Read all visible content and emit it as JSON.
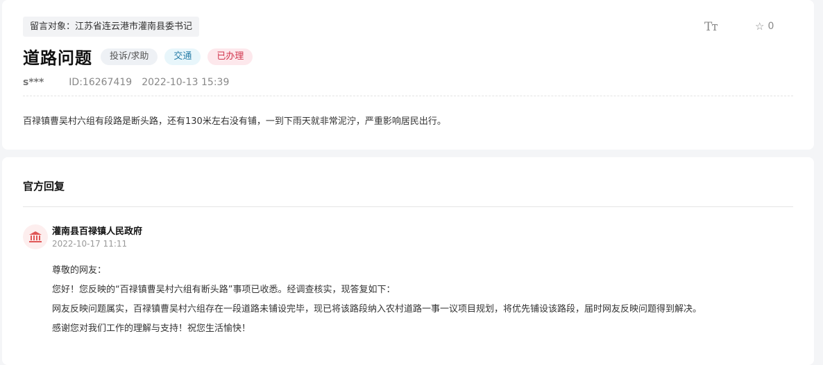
{
  "message": {
    "target": "留言对象：江苏省连云港市灌南县委书记",
    "font_icon_label": "Tт",
    "favorite_count": "0",
    "title": "道路问题",
    "tags": {
      "category": "投诉/求助",
      "field": "交通",
      "status": "已办理"
    },
    "user": "s***",
    "id_text": "ID:16267419",
    "time": "2022-10-13 15:39",
    "content": "百禄镇曹吴村六组有段路是断头路，还有130米左右没有铺，一到下雨天就非常泥泞，严重影响居民出行。"
  },
  "reply": {
    "heading": "官方回复",
    "org_name": "灌南县百禄镇人民政府",
    "time": "2022-10-17 11:11",
    "lines": [
      "尊敬的网友：",
      "您好！您反映的“百禄镇曹吴村六组有断头路”事项已收悉。经调查核实，现答复如下：",
      "网友反映问题属实，百禄镇曹吴村六组存在一段道路未铺设完毕，现已将该路段纳入农村道路一事一议项目规划，将优先铺设该路段，届时网友反映问题得到解决。",
      "感谢您对我们工作的理解与支持！祝您生活愉快！"
    ]
  },
  "icons": {
    "font_size": "font-size-icon",
    "favorite": "star-outline-icon",
    "org": "government-building-icon"
  },
  "colors": {
    "status_tag": "#d1344c",
    "field_tag": "#2a7fa8",
    "org_icon": "#e05555"
  }
}
